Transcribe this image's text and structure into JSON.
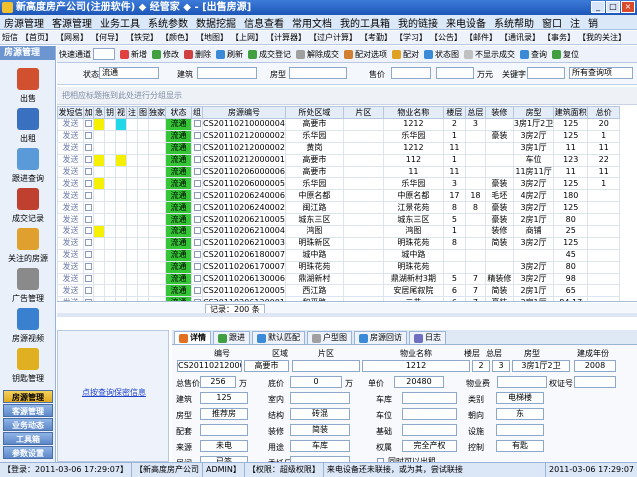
{
  "window": {
    "title": "新高度房产公司(注册软件) ◆ 经管家 ◆ - [出售房源]"
  },
  "menu": [
    "房源管理",
    "客源管理",
    "业务工具",
    "系统参数",
    "数据挖掘",
    "信息查看",
    "常用文档",
    "我的工具箱",
    "我的链接",
    "来电设备",
    "系统帮助",
    "窗口",
    "注",
    "销"
  ],
  "shortcuts": {
    "label": "短信",
    "items": [
      "【首页】",
      "【网易】",
      "【何导】",
      "【铁党】",
      "【颜色】",
      "【地图】",
      "【上网】",
      "【计算器】",
      "【过户计算】",
      "【考勤】",
      "【学习】",
      "【公告】",
      "【邮件】",
      "【通讯录】",
      "【事务】",
      "【我的关注】"
    ]
  },
  "sidebar": {
    "title": "房源管理",
    "items": [
      {
        "label": "出售",
        "icon": "house-sale-icon",
        "color": "#d05030"
      },
      {
        "label": "出租",
        "icon": "house-rent-icon",
        "color": "#3a70c0"
      },
      {
        "label": "跟进查询",
        "icon": "followup-search-icon",
        "color": "#5a9ad8"
      },
      {
        "label": "成交记录",
        "icon": "deal-record-icon",
        "color": "#c04030"
      },
      {
        "label": "关注的房源",
        "icon": "watched-house-icon",
        "color": "#e0a030"
      },
      {
        "label": "广告管理",
        "icon": "ad-manage-icon",
        "color": "#8a8a8a"
      },
      {
        "label": "房源视频",
        "icon": "video-icon",
        "color": "#3a80d0"
      },
      {
        "label": "钥匙管理",
        "icon": "key-icon",
        "color": "#e0b020"
      }
    ],
    "sections": [
      "房源管理",
      "客源管理",
      "业务动态",
      "工具箱",
      "参数设置"
    ]
  },
  "toolbar": {
    "items": [
      "快速通道",
      "新增",
      "修改",
      "删除",
      "刷新",
      "成交登记",
      "解除成交",
      "配对选项",
      "配对",
      "状态图",
      "不显示成交",
      "查询",
      "复位"
    ],
    "quick_value": ""
  },
  "filter": {
    "status_label": "状态",
    "status_value": "流通",
    "building_label": "建筑",
    "building_value": "",
    "house_label": "房型",
    "house_value": "",
    "price_label": "售价",
    "price_unit": "万元",
    "keyword_label": "关键字",
    "keyword_value": "",
    "all_query": "所有查询项"
  },
  "group_hint": "把相应标题拖到此处进行分组显示",
  "grid": {
    "headers": [
      "发短信",
      "加",
      "急",
      "钥",
      "视",
      "注",
      "图",
      "独家",
      "状态",
      "组",
      "房源编号",
      "所处区域",
      "片区",
      "物业名称",
      "楼层",
      "总层",
      "装修",
      "房型",
      "建筑面积",
      "总价"
    ],
    "rows": [
      {
        "send": "发送",
        "status": "流通",
        "code": "CS20110210000004",
        "region": "高要市",
        "area": "",
        "name": "1212",
        "floor": "2",
        "total": "3",
        "deco": "",
        "type": "3房1厅2卫",
        "size": "125",
        "price": "20"
      },
      {
        "send": "发送",
        "status": "流通",
        "code": "CS20110212000002",
        "region": "乐华园",
        "area": "",
        "name": "乐华园",
        "floor": "1",
        "total": "",
        "deco": "豪装",
        "type": "3房2厅",
        "size": "125",
        "price": "1"
      },
      {
        "send": "发送",
        "status": "流通",
        "code": "CS20110212000002",
        "region": "黄岗",
        "area": "",
        "name": "1212",
        "floor": "11",
        "total": "",
        "deco": "",
        "type": "3房1厅",
        "size": "11",
        "price": "11"
      },
      {
        "send": "发送",
        "status": "流通",
        "code": "CS20110212000001",
        "region": "高要市",
        "area": "",
        "name": "112",
        "floor": "1",
        "total": "",
        "deco": "",
        "type": "车位",
        "size": "123",
        "price": "22"
      },
      {
        "send": "发送",
        "status": "流通",
        "code": "CS20110206000006",
        "region": "高要市",
        "area": "",
        "name": "11",
        "floor": "11",
        "total": "",
        "deco": "",
        "type": "11房11厅",
        "size": "11",
        "price": "11"
      },
      {
        "send": "发送",
        "status": "流通",
        "code": "CS20110206000005",
        "region": "乐华园",
        "area": "",
        "name": "乐华园",
        "floor": "3",
        "total": "",
        "deco": "豪装",
        "type": "3房2厅",
        "size": "125",
        "price": "1"
      },
      {
        "send": "发送",
        "status": "流通",
        "code": "CS20110206240006",
        "region": "中原名都",
        "area": "",
        "name": "中原名都",
        "floor": "17",
        "total": "18",
        "deco": "毛坯",
        "type": "4房2厅",
        "size": "180",
        "price": ""
      },
      {
        "send": "发送",
        "status": "流通",
        "code": "CS20110206240002",
        "region": "闽江路",
        "area": "",
        "name": "江景花苑",
        "floor": "8",
        "total": "8",
        "deco": "豪装",
        "type": "3房2厅",
        "size": "125",
        "price": ""
      },
      {
        "send": "发送",
        "status": "流通",
        "code": "CS20110206210005",
        "region": "城东三区",
        "area": "",
        "name": "城东三区",
        "floor": "5",
        "total": "",
        "deco": "豪装",
        "type": "2房1厅",
        "size": "80",
        "price": ""
      },
      {
        "send": "发送",
        "status": "流通",
        "code": "CS20110206210004",
        "region": "鸿图",
        "area": "",
        "name": "鸿图",
        "floor": "1",
        "total": "",
        "deco": "装修",
        "type": "商铺",
        "size": "25",
        "price": ""
      },
      {
        "send": "发送",
        "status": "流通",
        "code": "CS20110206210003",
        "region": "明珠新区",
        "area": "",
        "name": "明珠花苑",
        "floor": "8",
        "total": "",
        "deco": "简装",
        "type": "3房2厅",
        "size": "125",
        "price": ""
      },
      {
        "send": "发送",
        "status": "流通",
        "code": "CS20110206180007",
        "region": "城中路",
        "area": "",
        "name": "城中路",
        "floor": "",
        "total": "",
        "deco": "",
        "type": "",
        "size": "45",
        "price": ""
      },
      {
        "send": "发送",
        "status": "流通",
        "code": "CS20110206170007",
        "region": "明珠花苑",
        "area": "",
        "name": "明珠花苑",
        "floor": "",
        "total": "",
        "deco": "",
        "type": "3房2厅",
        "size": "80",
        "price": ""
      },
      {
        "send": "发送",
        "status": "流通",
        "code": "CS20110206130006",
        "region": "鼎湖新村",
        "area": "",
        "name": "鼎湖新村3期",
        "floor": "5",
        "total": "7",
        "deco": "精装修",
        "type": "3房2厅",
        "size": "98",
        "price": ""
      },
      {
        "send": "发送",
        "status": "流通",
        "code": "CS20110206120005",
        "region": "西江路",
        "area": "",
        "name": "安居尾叙院",
        "floor": "6",
        "total": "7",
        "deco": "简装",
        "type": "2房1厅",
        "size": "65",
        "price": ""
      },
      {
        "send": "发送",
        "status": "流通",
        "code": "CS20110206120001",
        "region": "和平路",
        "area": "",
        "name": "二巷",
        "floor": "6",
        "total": "7",
        "deco": "豪装",
        "type": "3房1厅",
        "size": "84.17",
        "price": ""
      }
    ]
  },
  "record_count": "记录：200 条",
  "left_panel_link": "点按查询保密信息",
  "tabs": [
    "详情",
    "跟进",
    "默认匹配",
    "户型图",
    "房源回访",
    "日志"
  ],
  "detail": {
    "code_label": "编号",
    "code": "CS2011021200004",
    "region_label": "区域",
    "region": "高要市",
    "area_label": "片区",
    "area": "",
    "prop_label": "物业名称",
    "prop": "1212",
    "floor_label": "楼层",
    "floor": "2",
    "total_label": "总层",
    "total": "3",
    "type_label": "房型",
    "type": "3房1厅2卫",
    "year_label": "建成年份",
    "year": "2008",
    "price_label": "总售价",
    "price": "256",
    "price_unit": "万",
    "down_label": "底价",
    "down": "0",
    "down_unit": "万",
    "unit_label": "单价",
    "unit": "20480",
    "fee_label": "物业费",
    "fee": "",
    "cert_label": "权证号",
    "cert": "",
    "size_label": "建筑",
    "size": "125",
    "inner_label": "室内",
    "inner": "",
    "garage_label": "车库",
    "garage": "",
    "cat_label": "类别",
    "cat": "电梯楼",
    "style_label": "房型",
    "style": "推荐房",
    "struct_label": "结构",
    "struct": "砖混",
    "park_label": "车位",
    "park": "",
    "orient_label": "朝向",
    "orient": "东",
    "conf_label": "配套",
    "conf": "",
    "deco_label": "装修",
    "deco": "简装",
    "base_label": "基础",
    "base": "",
    "equip_label": "设施",
    "equip": "",
    "src_label": "来源",
    "src": "未电",
    "use_label": "用途",
    "use": "车库",
    "right_label": "权属",
    "right": "完全产权",
    "ctrl_label": "控制",
    "ctrl": "有匙",
    "live_label": "居间",
    "live": "已签",
    "remark_label": "委托日期",
    "remark": "",
    "sync_label": "同时可以出租"
  },
  "status": {
    "login": "【登录：2011-03-06 17:29:07】",
    "company": "【新高度房产公司",
    "user": "ADMIN】",
    "perm": "【权限：超级权限】",
    "msg": "来电设备还未联接，或为其，尝试联接",
    "time": "2011-03-06 17:29:07"
  }
}
